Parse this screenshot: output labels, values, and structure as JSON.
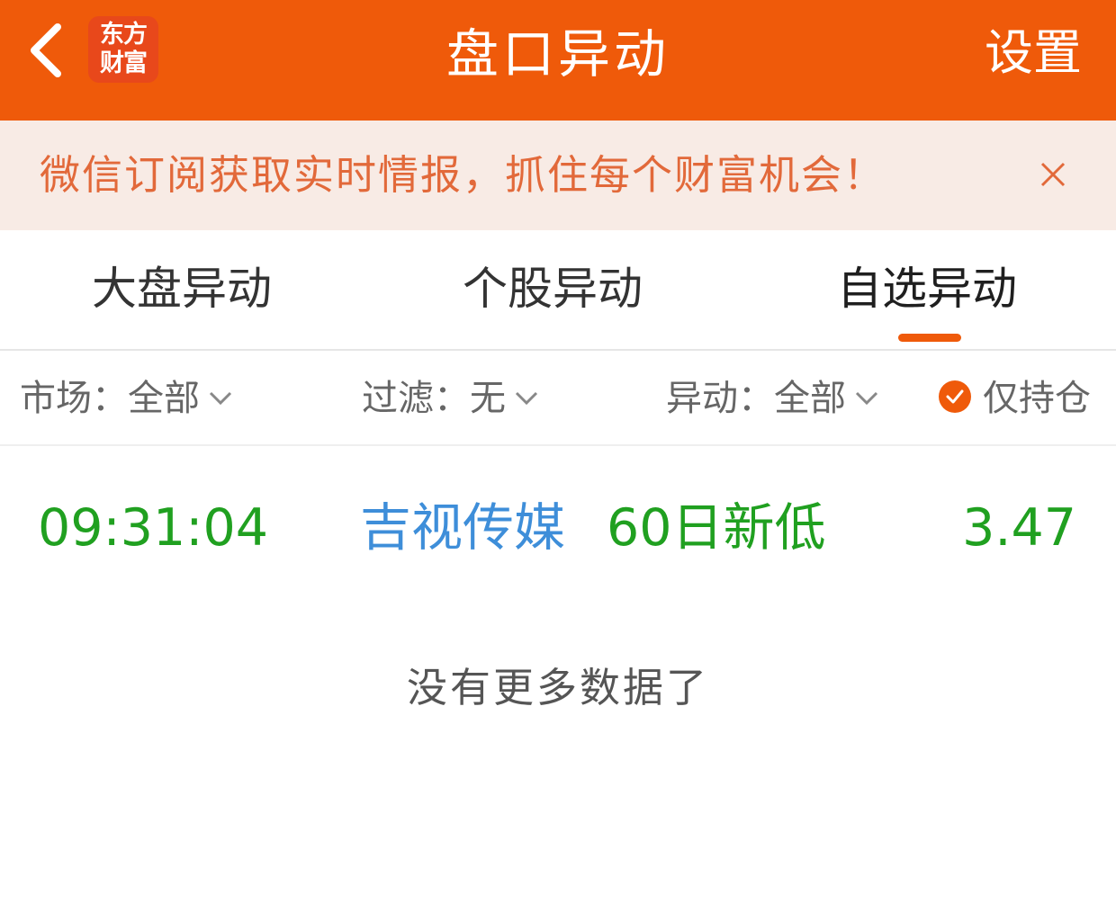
{
  "header": {
    "title": "盘口异动",
    "settings_label": "设置",
    "logo_line1": "东方",
    "logo_line2": "财富",
    "back_icon": "chevron-left-icon"
  },
  "banner": {
    "text": "微信订阅获取实时情报，抓住每个财富机会！",
    "close_icon": "close-icon"
  },
  "tabs": [
    {
      "label": "大盘异动",
      "active": false
    },
    {
      "label": "个股异动",
      "active": false
    },
    {
      "label": "自选异动",
      "active": true
    }
  ],
  "filters": {
    "market": "市场：全部",
    "filter": "过滤：无",
    "change": "异动：全部",
    "holdings_only": "仅持仓",
    "holdings_checked": true
  },
  "rows": [
    {
      "time": "09:31:04",
      "name": "吉视传媒",
      "event": "60日新低",
      "price": "3.47"
    }
  ],
  "footer_text": "没有更多数据了",
  "colors": {
    "accent": "#ef5a0a",
    "banner_bg": "#f8ebe5",
    "banner_text": "#e2693a",
    "down_green": "#20a020",
    "link_blue": "#3e8ed9"
  }
}
